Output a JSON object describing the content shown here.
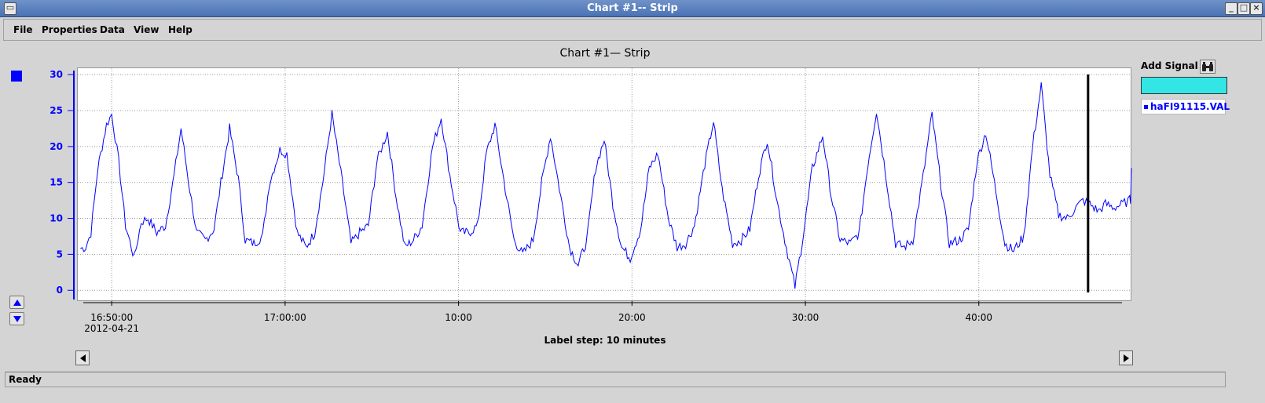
{
  "window": {
    "title": "Chart #1-- Strip"
  },
  "menu": {
    "items": [
      "File",
      "Properties",
      "Data",
      "View",
      "Help"
    ]
  },
  "side_panel": {
    "add_signal_label": "Add Signal",
    "signal_input_value": "",
    "legend_entries": [
      "haFI91115.VAL"
    ]
  },
  "status": {
    "text": "Ready"
  },
  "colors": {
    "series": "#0000ff",
    "axis": "#0000ff",
    "signal_input_bg": "#33e6e6",
    "cursor": "#000000"
  },
  "icons": {
    "add_signal_button": "binoculars-icon",
    "scroll_up": "triangle-up-icon",
    "scroll_down": "triangle-down-icon",
    "scroll_left": "triangle-left-icon",
    "scroll_right": "triangle-right-icon"
  },
  "chart_data": {
    "type": "line",
    "title": "Chart #1— Strip",
    "footer_label": "Label step: 10 minutes",
    "x_ticks": [
      {
        "t": 0,
        "label": "16:50:00",
        "sublabel": "2012-04-21"
      },
      {
        "t": 10,
        "label": "17:00:00",
        "sublabel": ""
      },
      {
        "t": 20,
        "label": "10:00",
        "sublabel": ""
      },
      {
        "t": 30,
        "label": "20:00",
        "sublabel": ""
      },
      {
        "t": 40,
        "label": "30:00",
        "sublabel": ""
      },
      {
        "t": 50,
        "label": "40:00",
        "sublabel": ""
      }
    ],
    "x_range": [
      -2,
      58.8
    ],
    "y_ticks": [
      0,
      5,
      10,
      15,
      20,
      25,
      30
    ],
    "ylim": [
      -1.5,
      31
    ],
    "grid": true,
    "cursor_t": 56.3,
    "series": [
      {
        "name": "haFI91115.VAL",
        "t": [
          -1.8,
          -1.5,
          -1.2,
          -0.8,
          -0.3,
          0.0,
          0.4,
          0.8,
          1.3,
          1.7,
          2.1,
          2.6,
          3.1,
          3.6,
          4.0,
          4.5,
          4.9,
          5.4,
          5.9,
          6.3,
          6.8,
          7.3,
          7.7,
          8.2,
          8.7,
          9.1,
          9.7,
          10.1,
          10.7,
          11.2,
          11.7,
          12.2,
          12.7,
          13.3,
          13.8,
          14.3,
          14.8,
          15.3,
          15.9,
          16.4,
          16.9,
          17.4,
          17.9,
          18.5,
          19.0,
          19.5,
          20.1,
          20.6,
          21.1,
          21.6,
          22.1,
          22.7,
          23.2,
          23.7,
          24.3,
          24.8,
          25.3,
          25.9,
          26.4,
          26.9,
          27.4,
          27.9,
          28.4,
          28.9,
          29.4,
          29.9,
          30.5,
          31.0,
          31.5,
          32.1,
          32.6,
          33.1,
          33.6,
          34.2,
          34.7,
          35.2,
          35.8,
          36.3,
          36.8,
          37.3,
          37.8,
          38.4,
          38.9,
          39.4,
          39.9,
          40.4,
          41.0,
          41.5,
          42.0,
          42.6,
          43.1,
          43.6,
          44.1,
          44.7,
          45.2,
          45.7,
          46.2,
          46.8,
          47.3,
          47.8,
          48.3,
          48.9,
          49.4,
          49.9,
          50.4,
          50.9,
          51.5,
          52.0,
          52.6,
          53.1,
          53.6,
          54.1,
          54.6,
          55.1,
          55.6,
          56.0,
          56.4,
          56.9,
          57.3,
          57.8,
          58.3,
          58.7,
          58.8
        ],
        "values": [
          5.8,
          6.0,
          8.0,
          17.0,
          23.0,
          24.5,
          18.0,
          9.0,
          4.5,
          9.5,
          10.0,
          8.0,
          9.0,
          16.0,
          22.5,
          14.0,
          8.0,
          7.0,
          8.5,
          15.0,
          22.5,
          15.5,
          7.0,
          6.5,
          7.5,
          15.0,
          19.5,
          19.0,
          8.0,
          6.0,
          8.0,
          15.5,
          24.5,
          15.0,
          6.5,
          8.0,
          9.0,
          18.0,
          22.0,
          13.0,
          6.0,
          7.0,
          9.0,
          20.0,
          24.0,
          16.0,
          8.0,
          8.0,
          9.0,
          19.0,
          23.0,
          14.0,
          7.0,
          5.0,
          7.0,
          15.0,
          21.5,
          13.0,
          6.0,
          3.5,
          7.0,
          17.0,
          21.0,
          12.0,
          6.0,
          4.5,
          8.5,
          17.0,
          19.0,
          10.0,
          6.0,
          6.5,
          9.0,
          17.5,
          23.5,
          14.0,
          6.5,
          7.0,
          8.5,
          16.0,
          21.0,
          12.0,
          6.0,
          0.5,
          8.0,
          17.0,
          21.5,
          13.0,
          7.0,
          6.5,
          8.0,
          17.5,
          25.0,
          15.0,
          6.5,
          6.0,
          7.0,
          16.0,
          24.5,
          15.0,
          6.5,
          7.0,
          8.5,
          18.0,
          22.0,
          15.0,
          6.5,
          5.5,
          7.5,
          20.0,
          28.5,
          16.0,
          10.5,
          10.0,
          11.5,
          12.5,
          12.0,
          11.0,
          12.0,
          11.5,
          12.0,
          12.5,
          12.5,
          11.5,
          17.0
        ]
      }
    ]
  }
}
